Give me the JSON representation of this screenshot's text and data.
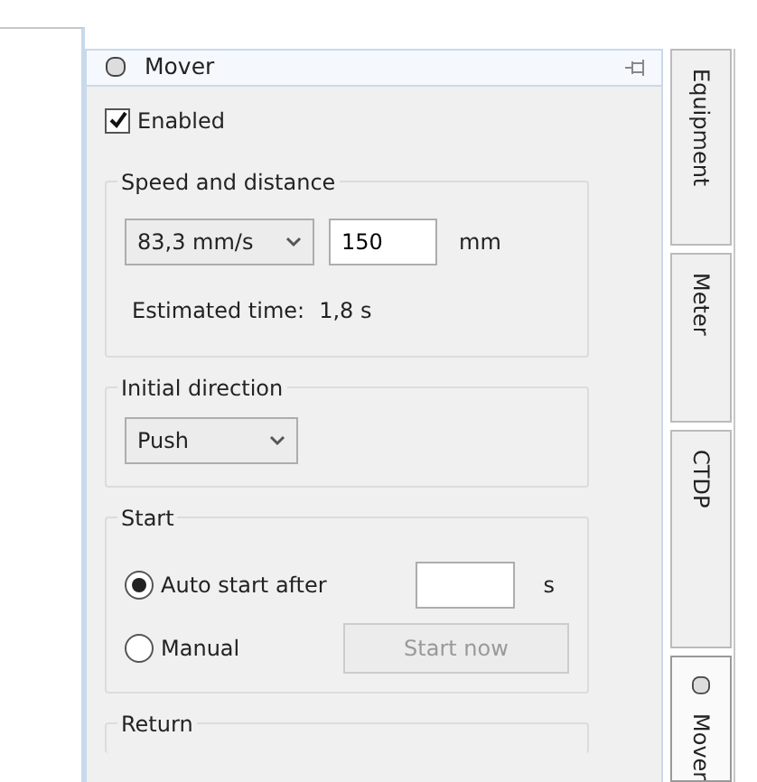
{
  "panel": {
    "title": "Mover"
  },
  "enabled": {
    "label": "Enabled",
    "checked": true
  },
  "speed_group": {
    "legend": "Speed and distance",
    "speed": "83,3 mm/s",
    "distance": "150",
    "unit": "mm",
    "estimate_label": "Estimated time:",
    "estimate_value": "1,8 s"
  },
  "direction_group": {
    "legend": "Initial direction",
    "value": "Push"
  },
  "start_group": {
    "legend": "Start",
    "options": [
      {
        "label": "Auto start after",
        "selected": true
      },
      {
        "label": "Manual",
        "selected": false
      }
    ],
    "delay_unit": "s",
    "button": {
      "label": "Start now",
      "disabled": true
    }
  },
  "return_group": {
    "legend": "Return"
  },
  "side_tabs": [
    {
      "label": "Equipment",
      "selected": false,
      "kind": "text"
    },
    {
      "label": "Meter",
      "selected": false,
      "kind": "text"
    },
    {
      "label": "CTDP",
      "selected": false,
      "kind": "text"
    },
    {
      "label": "Mover",
      "selected": true,
      "kind": "icon"
    }
  ]
}
